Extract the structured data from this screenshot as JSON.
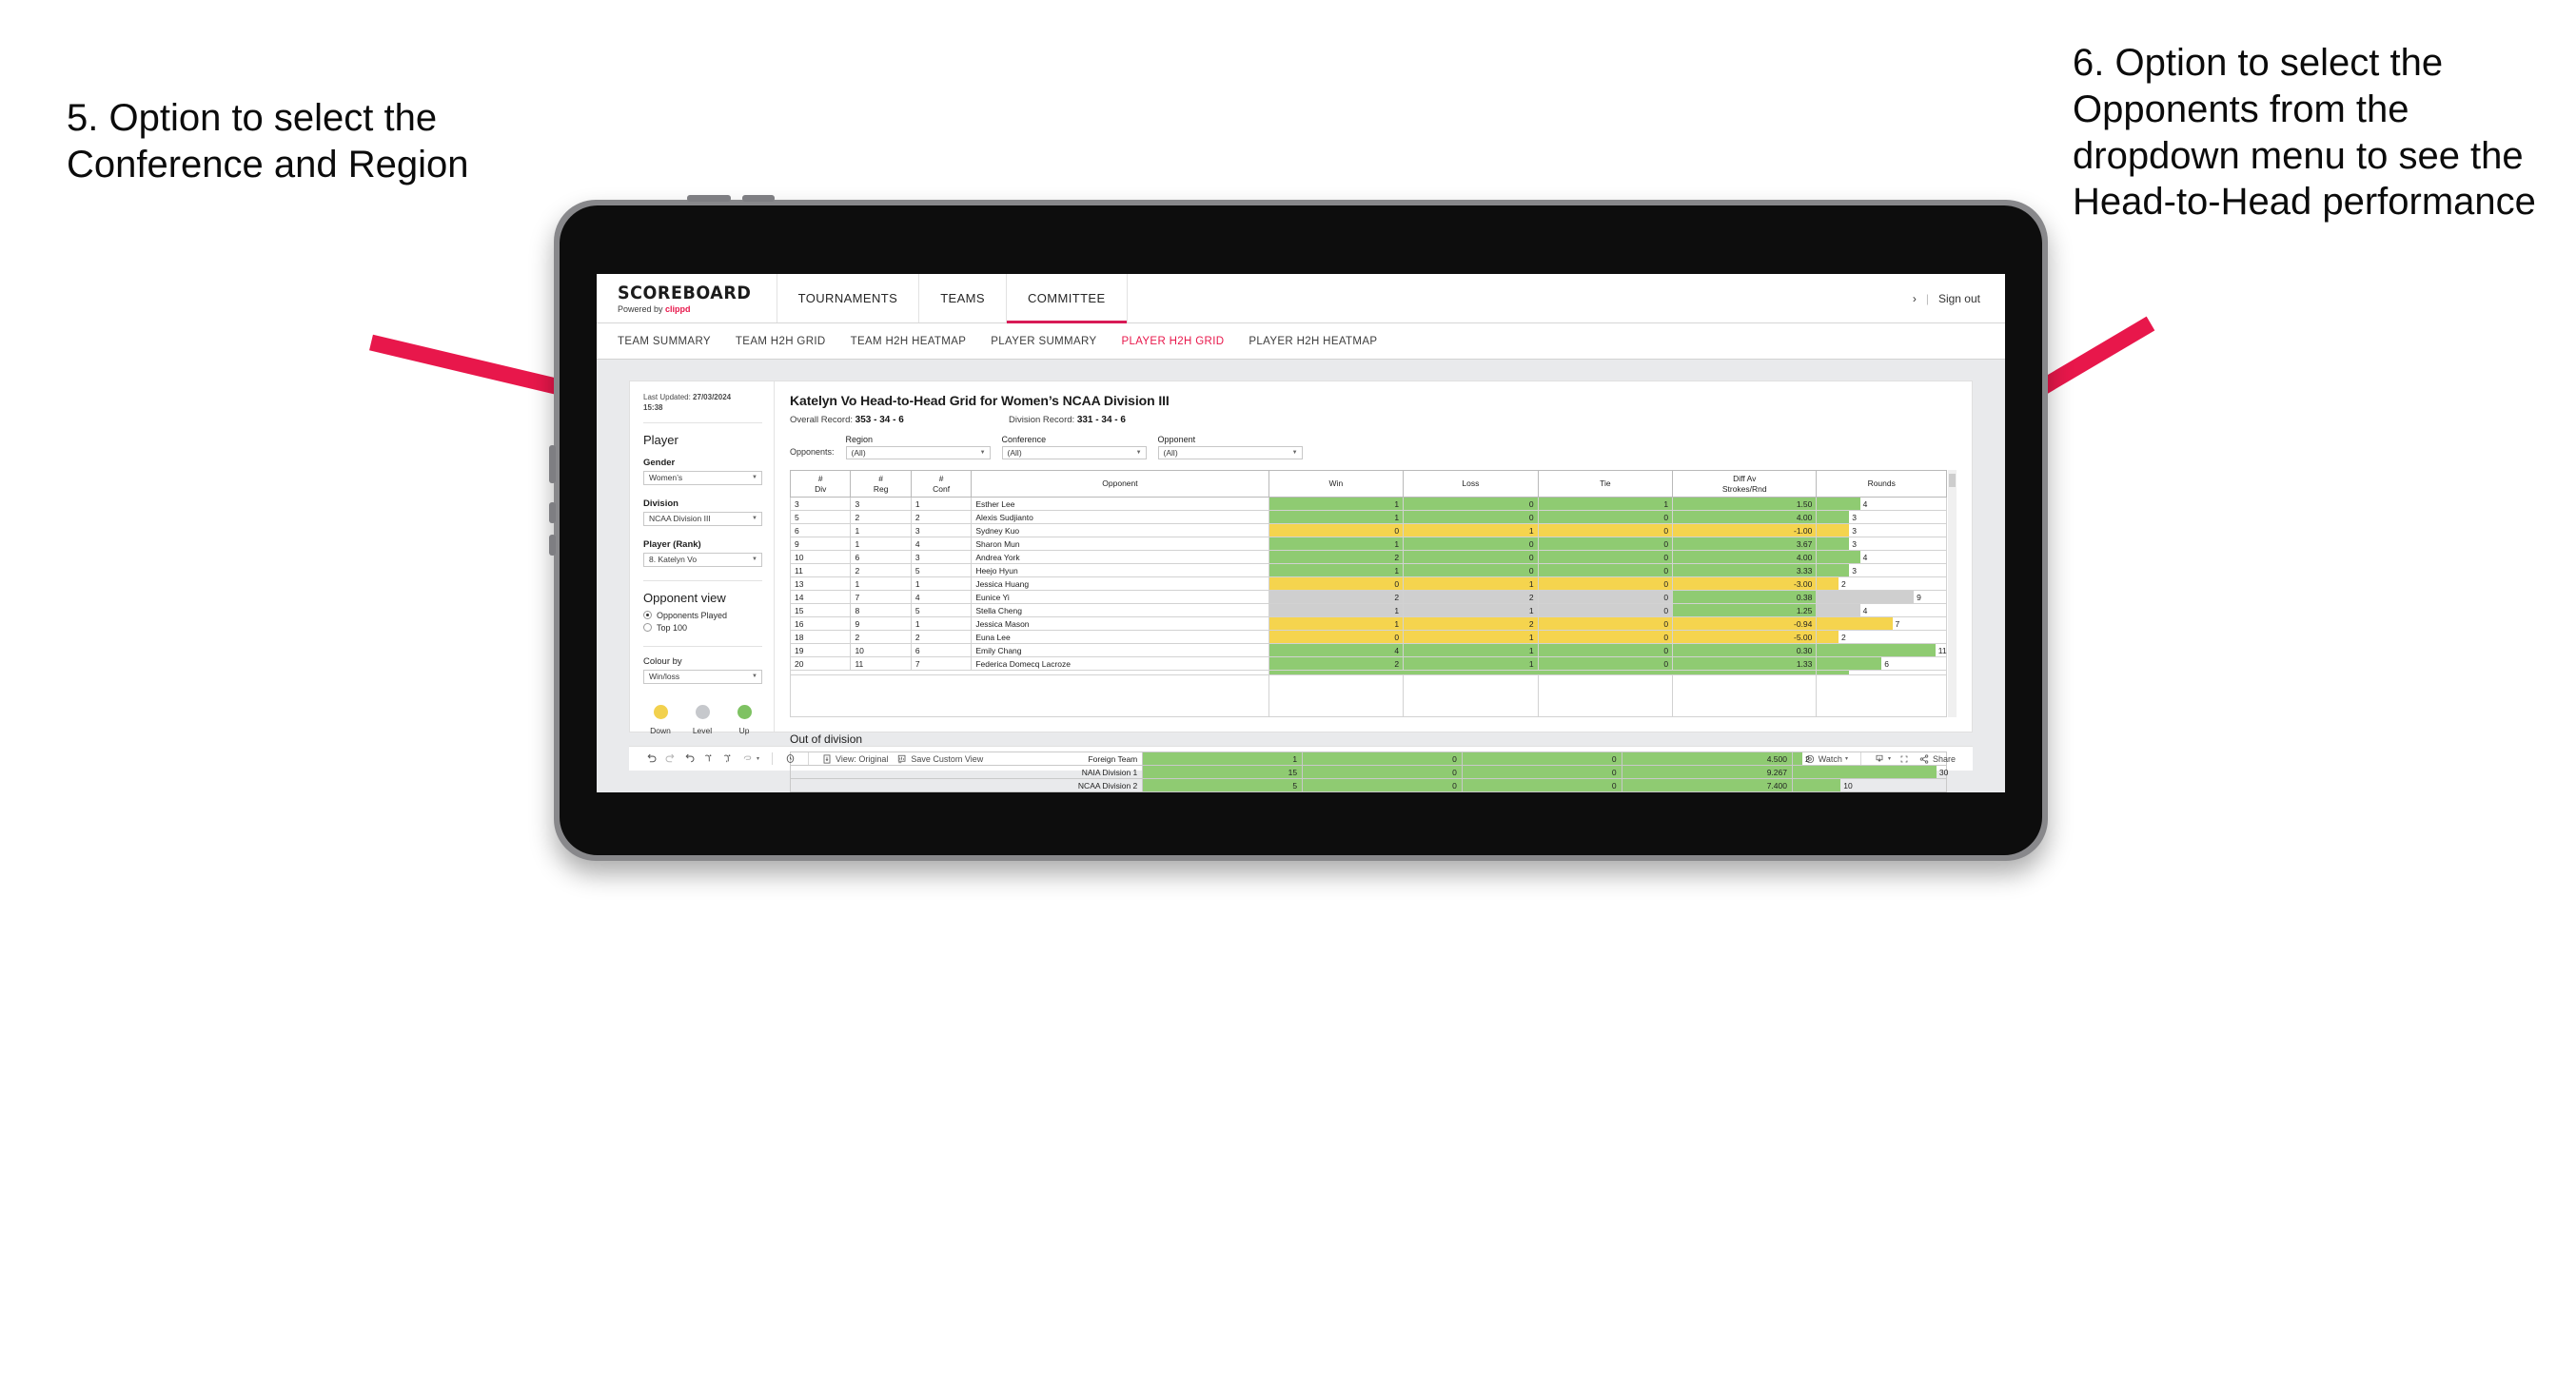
{
  "annotations": {
    "left": "5. Option to select the Conference and Region",
    "right": "6. Option to select the Opponents from the dropdown menu to see the Head-to-Head performance",
    "arrow_color": "#e8174b"
  },
  "topnav": {
    "brand_name": "SCOREBOARD",
    "brand_sub_prefix": "Powered by ",
    "brand_sub_brand": "clippd",
    "items": [
      {
        "label": "TOURNAMENTS",
        "active": false
      },
      {
        "label": "TEAMS",
        "active": false
      },
      {
        "label": "COMMITTEE",
        "active": true
      }
    ],
    "user_chevron": "›",
    "separator": "|",
    "sign_out": "Sign out"
  },
  "subnav": {
    "items": [
      {
        "label": "TEAM SUMMARY",
        "active": false
      },
      {
        "label": "TEAM H2H GRID",
        "active": false
      },
      {
        "label": "TEAM H2H HEATMAP",
        "active": false
      },
      {
        "label": "PLAYER SUMMARY",
        "active": false
      },
      {
        "label": "PLAYER H2H GRID",
        "active": true
      },
      {
        "label": "PLAYER H2H HEATMAP",
        "active": false
      }
    ],
    "active_color": "#e8174b"
  },
  "sidebar": {
    "last_updated_label": "Last Updated: ",
    "last_updated_value": "27/03/2024",
    "last_updated_time": "15:38",
    "player_heading": "Player",
    "gender_label": "Gender",
    "gender_value": "Women’s",
    "division_label": "Division",
    "division_value": "NCAA Division III",
    "player_rank_label": "Player (Rank)",
    "player_rank_value": "8. Katelyn Vo",
    "opponent_view_heading": "Opponent view",
    "opponent_view_options": [
      {
        "label": "Opponents Played",
        "selected": true
      },
      {
        "label": "Top 100",
        "selected": false
      }
    ],
    "colour_by_label": "Colour by",
    "colour_by_value": "Win/loss",
    "legend": [
      {
        "label": "Down",
        "color": "#f2d14e"
      },
      {
        "label": "Level",
        "color": "#c6c8cc"
      },
      {
        "label": "Up",
        "color": "#7ec262"
      }
    ]
  },
  "view": {
    "title": "Katelyn Vo Head-to-Head Grid for Women’s NCAA Division III",
    "overall_record_label": "Overall Record: ",
    "overall_record_value": "353 -  34 - 6",
    "division_record_label": "Division Record: ",
    "division_record_value": "331 -  34 - 6",
    "filters_label": "Opponents:",
    "filters": [
      {
        "label": "Region",
        "value": "(All)"
      },
      {
        "label": "Conference",
        "value": "(All)"
      },
      {
        "label": "Opponent",
        "value": "(All)"
      }
    ]
  },
  "chart_data": {
    "type": "table",
    "title": "Katelyn Vo Head-to-Head Grid for Women’s NCAA Division III",
    "columns": [
      "# Div",
      "# Reg",
      "# Conf",
      "Opponent",
      "Win",
      "Loss",
      "Tie",
      "Diff Av Strokes/Rnd",
      "Rounds"
    ],
    "header_lines": [
      [
        "#",
        "Div"
      ],
      [
        "#",
        "Reg"
      ],
      [
        "#",
        "Conf"
      ],
      [
        "Opponent",
        ""
      ],
      [
        "Win",
        ""
      ],
      [
        "Loss",
        ""
      ],
      [
        "Tie",
        ""
      ],
      [
        "Diff Av",
        "Strokes/Rnd"
      ],
      [
        "Rounds",
        ""
      ]
    ],
    "rounds_max": 12,
    "colors": {
      "win": "#8fcb72",
      "loss": "#f5d44e",
      "tie": "#cfcfcf"
    },
    "rows": [
      {
        "div": "3",
        "reg": "3",
        "conf": "1",
        "opponent": "Esther Lee",
        "win": "1",
        "loss": "0",
        "tie": "1",
        "diff": "1.50",
        "rounds": "4",
        "state": "win"
      },
      {
        "div": "5",
        "reg": "2",
        "conf": "2",
        "opponent": "Alexis Sudjianto",
        "win": "1",
        "loss": "0",
        "tie": "0",
        "diff": "4.00",
        "rounds": "3",
        "state": "win"
      },
      {
        "div": "6",
        "reg": "1",
        "conf": "3",
        "opponent": "Sydney Kuo",
        "win": "0",
        "loss": "1",
        "tie": "0",
        "diff": "-1.00",
        "rounds": "3",
        "state": "loss"
      },
      {
        "div": "9",
        "reg": "1",
        "conf": "4",
        "opponent": "Sharon Mun",
        "win": "1",
        "loss": "0",
        "tie": "0",
        "diff": "3.67",
        "rounds": "3",
        "state": "win"
      },
      {
        "div": "10",
        "reg": "6",
        "conf": "3",
        "opponent": "Andrea York",
        "win": "2",
        "loss": "0",
        "tie": "0",
        "diff": "4.00",
        "rounds": "4",
        "state": "win"
      },
      {
        "div": "11",
        "reg": "2",
        "conf": "5",
        "opponent": "Heejo Hyun",
        "win": "1",
        "loss": "0",
        "tie": "0",
        "diff": "3.33",
        "rounds": "3",
        "state": "win"
      },
      {
        "div": "13",
        "reg": "1",
        "conf": "1",
        "opponent": "Jessica Huang",
        "win": "0",
        "loss": "1",
        "tie": "0",
        "diff": "-3.00",
        "rounds": "2",
        "state": "loss"
      },
      {
        "div": "14",
        "reg": "7",
        "conf": "4",
        "opponent": "Eunice Yi",
        "win": "2",
        "loss": "2",
        "tie": "0",
        "diff": "0.38",
        "rounds": "9",
        "state": "tie",
        "diff_state": "win"
      },
      {
        "div": "15",
        "reg": "8",
        "conf": "5",
        "opponent": "Stella Cheng",
        "win": "1",
        "loss": "1",
        "tie": "0",
        "diff": "1.25",
        "rounds": "4",
        "state": "tie",
        "diff_state": "win"
      },
      {
        "div": "16",
        "reg": "9",
        "conf": "1",
        "opponent": "Jessica Mason",
        "win": "1",
        "loss": "2",
        "tie": "0",
        "diff": "-0.94",
        "rounds": "7",
        "state": "loss"
      },
      {
        "div": "18",
        "reg": "2",
        "conf": "2",
        "opponent": "Euna Lee",
        "win": "0",
        "loss": "1",
        "tie": "0",
        "diff": "-5.00",
        "rounds": "2",
        "state": "loss"
      },
      {
        "div": "19",
        "reg": "10",
        "conf": "6",
        "opponent": "Emily Chang",
        "win": "4",
        "loss": "1",
        "tie": "0",
        "diff": "0.30",
        "rounds": "11",
        "state": "win"
      },
      {
        "div": "20",
        "reg": "11",
        "conf": "7",
        "opponent": "Federica Domecq Lacroze",
        "win": "2",
        "loss": "1",
        "tie": "0",
        "diff": "1.33",
        "rounds": "6",
        "state": "win"
      }
    ],
    "out_of_division_title": "Out of division",
    "out_of_division_rounds_max": 32,
    "out_of_division": [
      {
        "name": "Foreign Team",
        "win": "1",
        "loss": "0",
        "tie": "0",
        "diff": "4.500",
        "rounds": "2",
        "state": "win"
      },
      {
        "name": "NAIA Division 1",
        "win": "15",
        "loss": "0",
        "tie": "0",
        "diff": "9.267",
        "rounds": "30",
        "state": "win"
      },
      {
        "name": "NCAA Division 2",
        "win": "5",
        "loss": "0",
        "tie": "0",
        "diff": "7.400",
        "rounds": "10",
        "state": "win"
      }
    ]
  },
  "toolbar": {
    "icons": [
      "undo-icon",
      "redo-icon",
      "revert-icon",
      "refresh-icon",
      "pause-icon",
      "highlight-icon"
    ],
    "highlight_caret": "▾",
    "clock_icon": "clock-icon",
    "view_original_label": "View: Original",
    "save_custom_view_label": "Save Custom View",
    "watch_label": "Watch",
    "watch_caret": "▾",
    "download_caret": "▾",
    "share_label": "Share"
  }
}
